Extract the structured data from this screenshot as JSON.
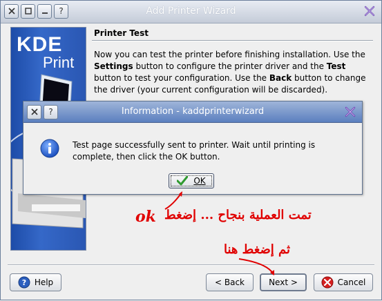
{
  "window": {
    "title": "Add Printer Wizard",
    "tbtn_question": "?"
  },
  "sidebar": {
    "logo_kde": "KDE",
    "logo_print": "Print"
  },
  "page": {
    "title": "Printer Test",
    "desc_1": "Now you can test the printer before finishing installation. Use the ",
    "desc_settings": "Settings",
    "desc_2": " button to configure the printer driver and the ",
    "desc_test": "Test",
    "desc_3": " button to test your configuration. Use the ",
    "desc_back": "Back",
    "desc_4": " button to change the driver (your current configuration will be discarded)."
  },
  "buttons": {
    "help": "Help",
    "back": "< Back",
    "next": "Next >",
    "cancel": "Cancel"
  },
  "dialog": {
    "title": "Information - kaddprinterwizard",
    "question": "?",
    "message": "Test page successfully sent to printer. Wait until printing is complete, then click the OK button.",
    "ok": "OK"
  },
  "annotations": {
    "ok_hint": "تمت العملية بنجاح ... إضغط",
    "ok_word": "ok",
    "next_hint": "ثم إضغط هنا"
  },
  "colors": {
    "accent": "#2a57b3",
    "annotation": "#e00000"
  }
}
